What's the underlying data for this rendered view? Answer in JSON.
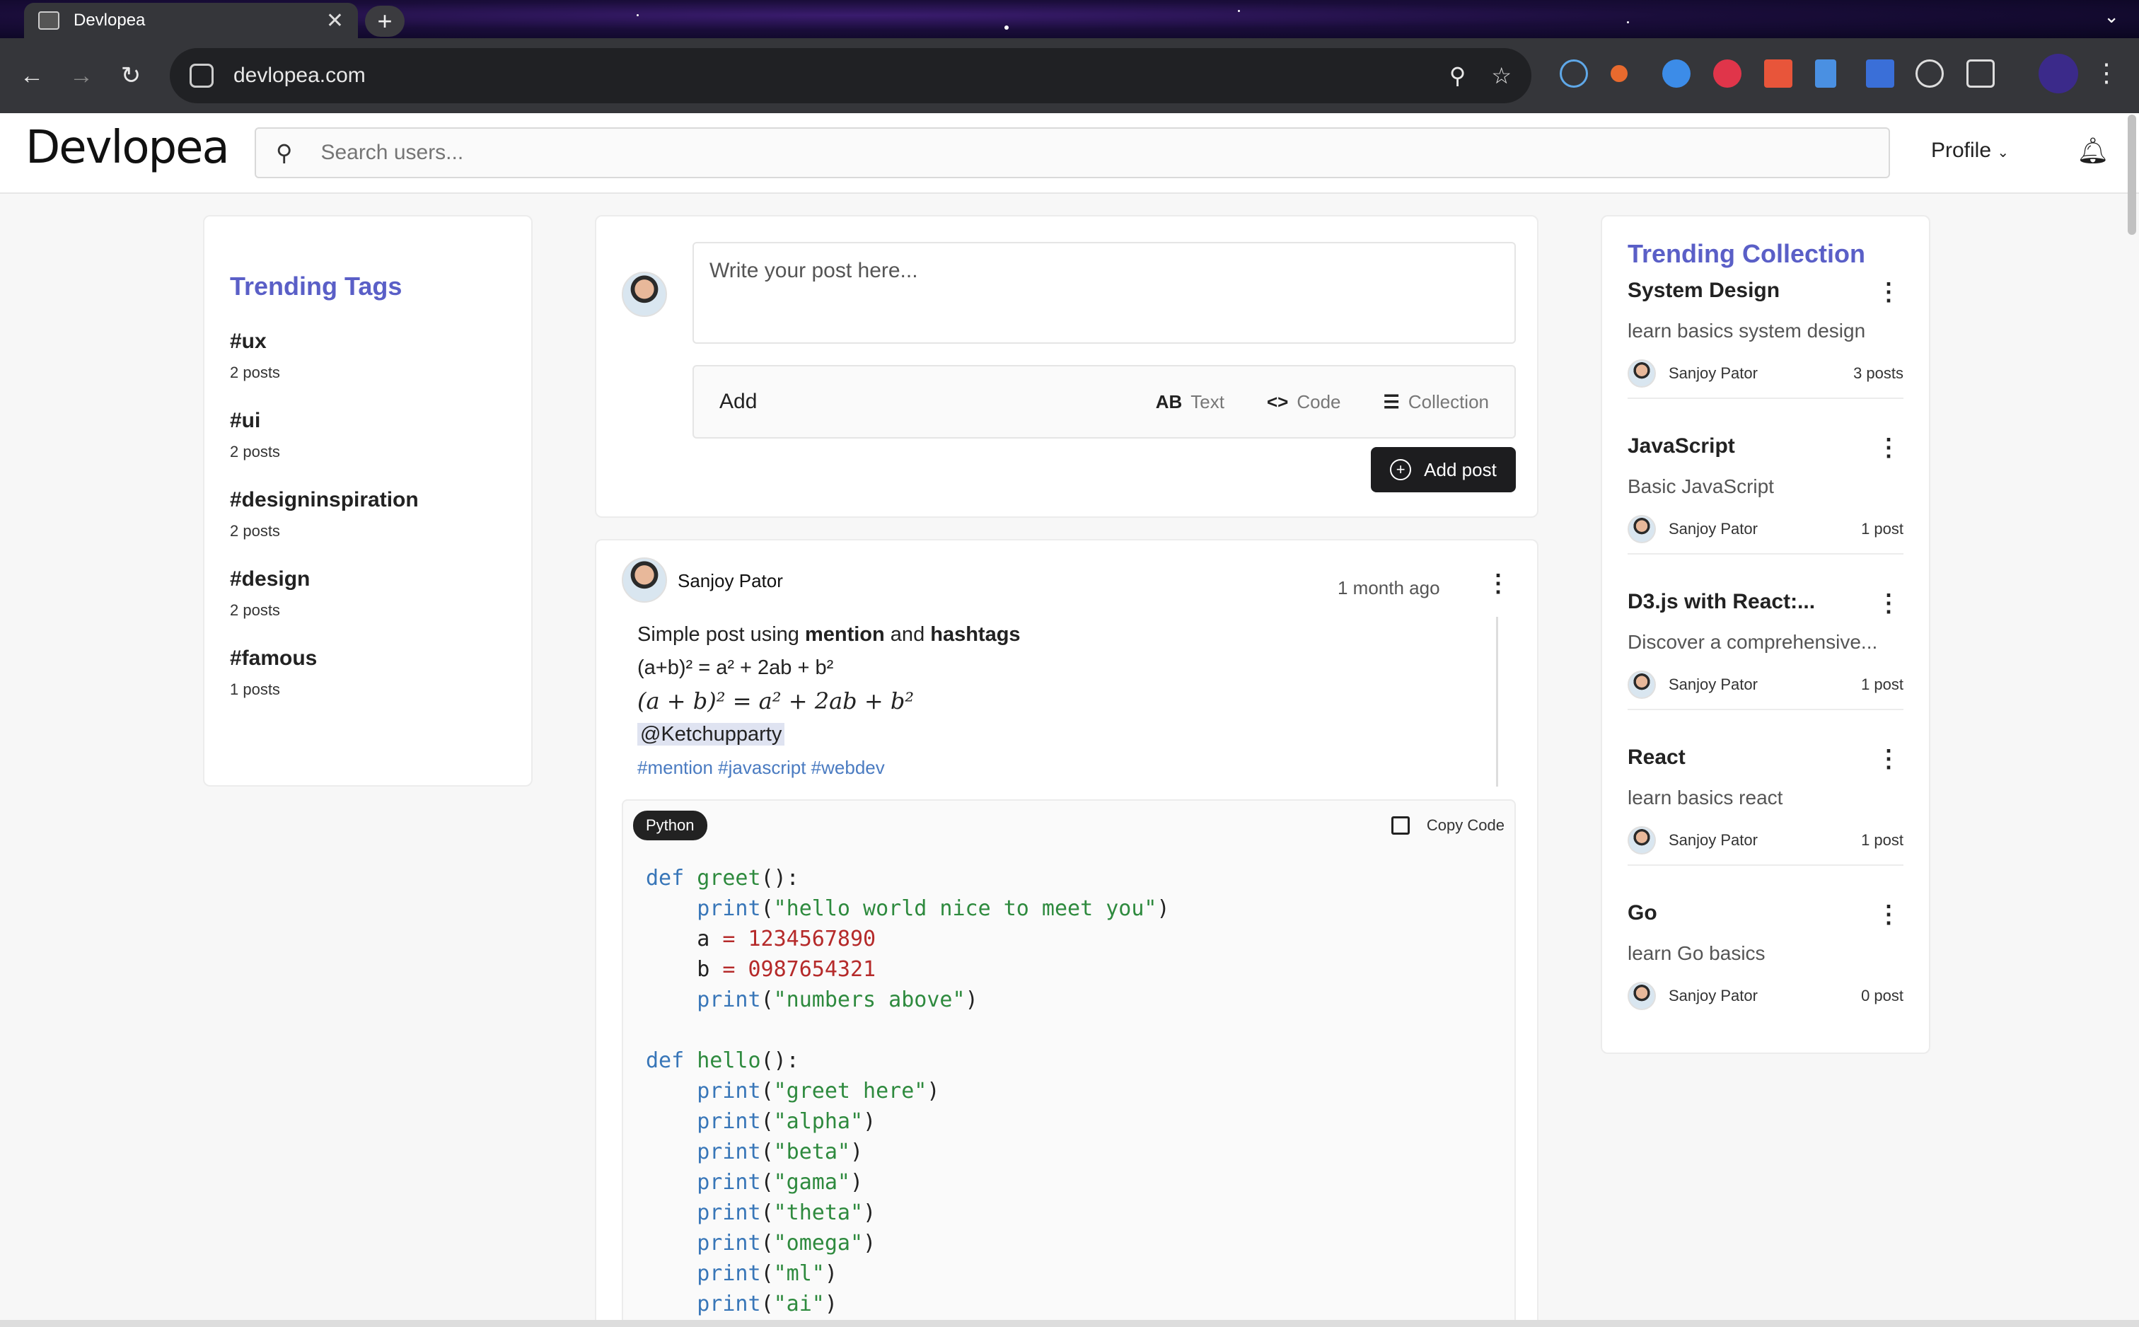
{
  "browser": {
    "tab_title": "Devlopea",
    "tab_close": "✕",
    "new_tab": "+",
    "url": "devlopea.com"
  },
  "header": {
    "logo": "Devlopea",
    "search_placeholder": "Search users...",
    "profile_label": "Profile"
  },
  "trending_tags": {
    "title": "Trending Tags",
    "items": [
      {
        "name": "#ux",
        "count": "2 posts"
      },
      {
        "name": "#ui",
        "count": "2 posts"
      },
      {
        "name": "#designinspiration",
        "count": "2 posts"
      },
      {
        "name": "#design",
        "count": "2 posts"
      },
      {
        "name": "#famous",
        "count": "1 posts"
      }
    ]
  },
  "composer": {
    "placeholder": "Write your post here...",
    "add_label": "Add",
    "opt_text": "Text",
    "opt_code": "Code",
    "opt_collection": "Collection",
    "add_post": "Add post"
  },
  "post": {
    "author": "Sanjoy Pator",
    "time": "1 month ago",
    "line1_pre": "Simple post using ",
    "line1_mention": "mention",
    "line1_mid": " and ",
    "line1_hashtags": "hashtags",
    "line2": "(a+b)² = a² + 2ab + b²",
    "line3": "(a + b)² = a² + 2ab + b²",
    "mention": "@Ketchupparty",
    "hashtags": "#mention #javascript #webdev",
    "language": "Python",
    "copy_label": "Copy Code"
  },
  "trending_collection": {
    "title": "Trending Collection",
    "items": [
      {
        "name": "System Design",
        "desc": "learn basics system design",
        "author": "Sanjoy Pator",
        "count": "3 posts"
      },
      {
        "name": "JavaScript",
        "desc": "Basic JavaScript",
        "author": "Sanjoy Pator",
        "count": "1 post"
      },
      {
        "name": "D3.js with React:...",
        "desc": "Discover a comprehensive...",
        "author": "Sanjoy Pator",
        "count": "1 post"
      },
      {
        "name": "React",
        "desc": "learn basics react",
        "author": "Sanjoy Pator",
        "count": "1 post"
      },
      {
        "name": "Go",
        "desc": "learn Go basics",
        "author": "Sanjoy Pator",
        "count": "0 post"
      }
    ]
  },
  "colors": {
    "accent": "#5a5fc7",
    "link": "#4a7bc1",
    "dark_button": "#1d1d1f"
  }
}
